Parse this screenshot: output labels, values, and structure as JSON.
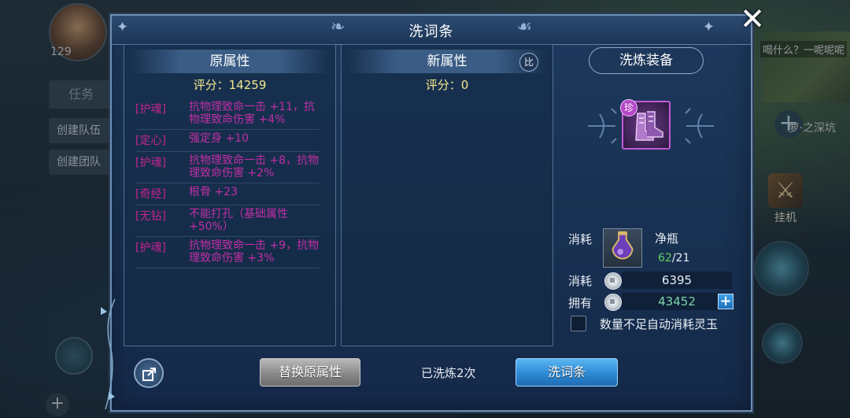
{
  "background": {
    "level": "129",
    "task_label": "任务",
    "create_team_label": "创建队伍",
    "create_group_label": "创建团队",
    "map_text": "喝什么？一呢呢呢",
    "quest_right": "萝·之深坑",
    "auto_label": "挂机"
  },
  "dialog": {
    "title": "洗词条",
    "close_icon": "close-icon"
  },
  "original": {
    "header": "原属性",
    "score": "评分：14259",
    "attributes": [
      {
        "tag": "[护魂]",
        "text": "抗物理致命一击 +11，抗物理致命伤害 +4%"
      },
      {
        "tag": "[定心]",
        "text": "强定身 +10"
      },
      {
        "tag": "[护魂]",
        "text": "抗物理致命一击 +8，抗物理致命伤害 +2%"
      },
      {
        "tag": "[奇经]",
        "text": "根骨 +23"
      },
      {
        "tag": "[无钻]",
        "text": "不能打孔（基础属性+50%）"
      },
      {
        "tag": "[护魂]",
        "text": "抗物理致命一击 +9，抗物理致命伤害 +3%"
      }
    ]
  },
  "new_attr": {
    "header": "新属性",
    "score": "评分：0",
    "compare_label": "比"
  },
  "equipment": {
    "header": "洗炼装备",
    "badge": "珍"
  },
  "cost": {
    "label1": "消耗",
    "item_name": "净瓶",
    "item_have": "62",
    "item_need": "/21",
    "label2": "消耗",
    "money_cost": "6395",
    "label3": "拥有",
    "money_own": "43452",
    "auto_consume_label": "数量不足自动消耗灵玉"
  },
  "bottom": {
    "replace_label": "替换原属性",
    "wash_count": "已洗炼2次",
    "wash_label": "洗词条"
  },
  "colors": {
    "attr_text": "#c02fa6",
    "score": "#f3e88a",
    "item_have": "#5fd05f",
    "money_own": "#7fd3a8"
  }
}
